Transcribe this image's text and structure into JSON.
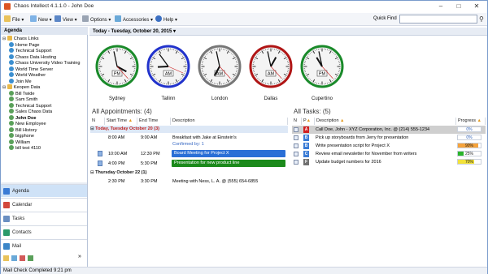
{
  "window": {
    "title": "Chaos Intellect 4.1.1.0 - John Doe"
  },
  "toolbar": {
    "file": "File",
    "new": "New",
    "view": "View",
    "options": "Options",
    "accessories": "Accessories",
    "help": "Help",
    "quick_find_label": "Quick Find",
    "quick_find_value": ""
  },
  "sidebar": {
    "header": "Agenda",
    "groups": [
      {
        "label": "Chaos Links",
        "items": [
          "Home Page",
          "Technical Support",
          "Chaos Data Hosting",
          "Chaos University Video Training",
          "World Time Server",
          "World Weather",
          "Join Me"
        ]
      },
      {
        "label": "Keopen Data",
        "items": [
          "Bill Twide",
          "Sam Smith",
          "Technical Support",
          "Sales Chaos Data",
          "John Doe",
          "New Employee",
          "Bill History",
          "bigphone",
          "William",
          "bill test 4110"
        ]
      }
    ],
    "nav": [
      "Agenda",
      "Calendar",
      "Tasks",
      "Contacts",
      "Mail"
    ]
  },
  "day_header": "Today - Tuesday, October 20, 2015",
  "clocks": [
    {
      "city": "Sydney",
      "color": "#1a8a2a",
      "ampm": "PM",
      "hour": 3,
      "minute": 58
    },
    {
      "city": "Tallinn",
      "color": "#2233cc",
      "ampm": "AM",
      "hour": 8,
      "minute": 54
    },
    {
      "city": "London",
      "color": "#777777",
      "ampm": "AM",
      "hour": 6,
      "minute": 58
    },
    {
      "city": "Dallas",
      "color": "#b01515",
      "ampm": "AM",
      "hour": 12,
      "minute": 58
    },
    {
      "city": "Cupertino",
      "color": "#1a8a2a",
      "ampm": "PM",
      "hour": 10,
      "minute": 58
    }
  ],
  "appointments": {
    "title": "All Appointments:",
    "count": "(4)",
    "columns": [
      "N",
      "Start Time",
      "End Time",
      "Description"
    ],
    "groups": [
      {
        "label": "Today, Tuesday October 20 (3)",
        "rows": [
          {
            "start": "8:00 AM",
            "end": "9:00 AM",
            "desc": "Breakfast with Jake at Einstein's",
            "sub": "Confirmed by: 1",
            "color": ""
          },
          {
            "start": "10:00 AM",
            "end": "12:30 PM",
            "desc": "Board Meeting for Project X",
            "sub": "",
            "color": "#2a6fd6"
          },
          {
            "start": "4:00 PM",
            "end": "5:30 PM",
            "desc": "Presentation for new product line",
            "sub": "",
            "color": "#1b8a1b"
          }
        ]
      },
      {
        "label": "Thursday October 22 (1)",
        "rows": [
          {
            "start": "2:30 PM",
            "end": "3:30 PM",
            "desc": "Meeting with Ness, L. A. @ (555) 654-6855",
            "sub": "",
            "color": ""
          }
        ]
      }
    ]
  },
  "tasks": {
    "title": "All Tasks:",
    "count": "(5)",
    "columns": [
      "N",
      "P",
      "Description",
      "Progress"
    ],
    "rows": [
      {
        "prio": "A",
        "prio_color": "#d21f1f",
        "desc": "Call Doe, John - XYZ Corporation, Inc. @ (214) 555-1234",
        "progress": 0,
        "progress_label": "0%",
        "fill": "#ffffff"
      },
      {
        "prio": "B",
        "prio_color": "#3a7bd5",
        "desc": "Pick up storyboards from Jerry for presentation",
        "progress": 0,
        "progress_label": "0%",
        "fill": "#ffffff"
      },
      {
        "prio": "B",
        "prio_color": "#3a7bd5",
        "desc": "Write presentation script for Project X",
        "progress": 90,
        "progress_label": "90%",
        "fill": "#f5a33c"
      },
      {
        "prio": "C",
        "prio_color": "#3a7bd5",
        "desc": "Review email newsletter for November from writers",
        "progress": 25,
        "progress_label": "25%",
        "fill": "#2ab52a"
      },
      {
        "prio": "F",
        "prio_color": "#707070",
        "desc": "Update budget numbers for 2016",
        "progress": 70,
        "progress_label": "70%",
        "fill": "#f2e23a"
      }
    ]
  },
  "status": "Mail Check Completed 9:21 pm"
}
